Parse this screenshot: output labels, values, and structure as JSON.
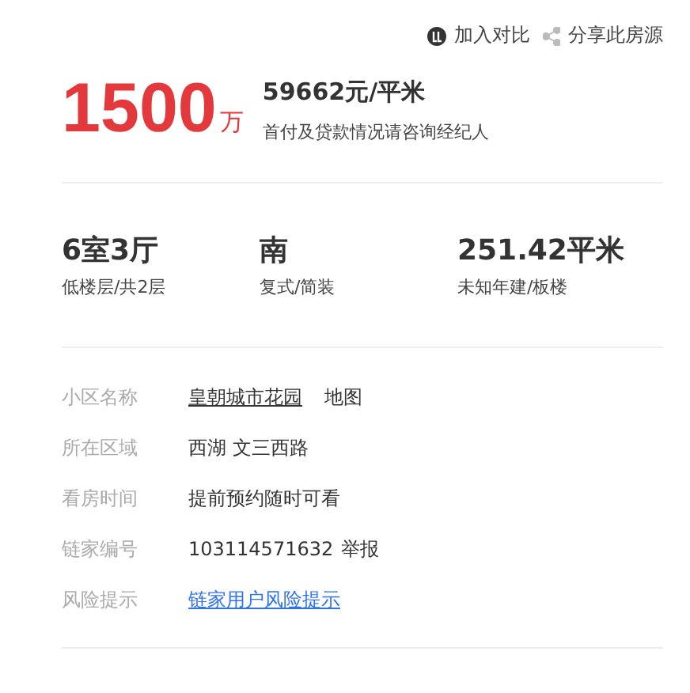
{
  "actions": [
    {
      "kind": "compare",
      "label": "加入对比"
    },
    {
      "kind": "share",
      "label": "分享此房源"
    }
  ],
  "price": {
    "total": "1500",
    "unit": "万",
    "per_area": "59662元/平米",
    "note": "首付及贷款情况请咨询经纪人"
  },
  "stats": [
    {
      "main": "6室3厅",
      "sub": "低楼层/共2层"
    },
    {
      "main": "南",
      "sub": "复式/简装"
    },
    {
      "main": "251.42平米",
      "sub": "未知年建/板楼"
    }
  ],
  "info": [
    {
      "label": "小区名称",
      "parts": [
        {
          "kind": "link",
          "text": "皇朝城市花园"
        },
        {
          "kind": "action",
          "text": "地图"
        }
      ]
    },
    {
      "label": "所在区域",
      "parts": [
        {
          "kind": "text",
          "text": "西湖 文三西路"
        }
      ]
    },
    {
      "label": "看房时间",
      "parts": [
        {
          "kind": "text",
          "text": "提前预约随时可看"
        }
      ]
    },
    {
      "label": "链家编号",
      "parts": [
        {
          "kind": "text",
          "text": "103114571632"
        },
        {
          "kind": "action",
          "text": "举报"
        }
      ]
    },
    {
      "label": "风险提示",
      "parts": [
        {
          "kind": "blue-link",
          "text": "链家用户风险提示"
        }
      ]
    }
  ]
}
